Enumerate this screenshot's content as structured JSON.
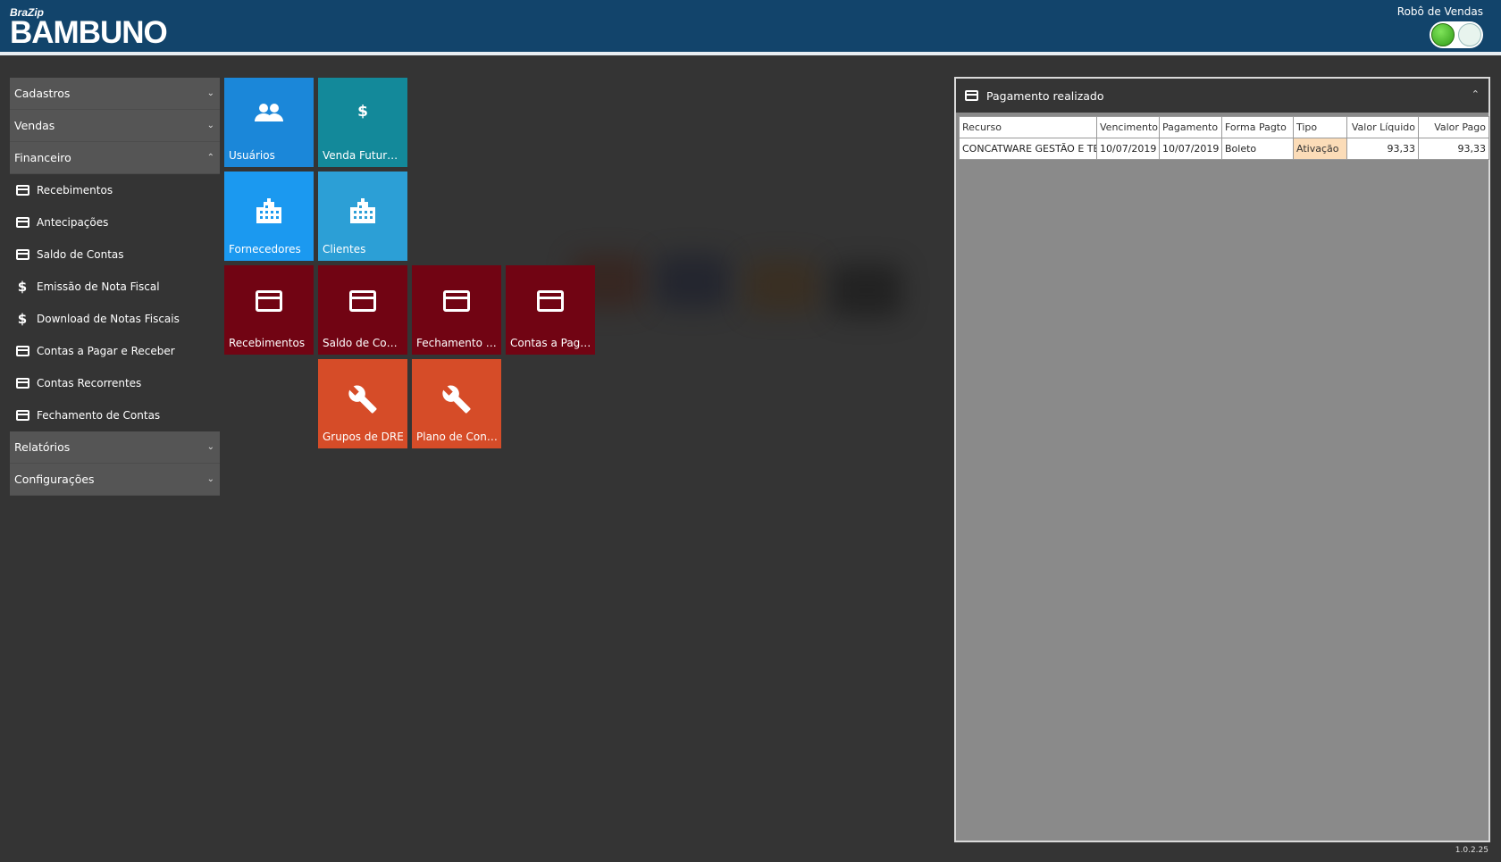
{
  "header": {
    "brand_small": "BraZip",
    "brand_big": "BAMBUNO",
    "robo_label": "Robô de Vendas"
  },
  "sidebar": {
    "groups_top": [
      {
        "label": "Cadastros",
        "chevron": "chevron-down-icon"
      },
      {
        "label": "Vendas",
        "chevron": "chevron-down-icon"
      },
      {
        "label": "Financeiro",
        "chevron": "chevron-up-icon"
      }
    ],
    "items": [
      {
        "label": "Recebimentos",
        "icon": "card-icon"
      },
      {
        "label": "Antecipações",
        "icon": "card-icon"
      },
      {
        "label": "Saldo de Contas",
        "icon": "card-icon"
      },
      {
        "label": "Emissão de Nota Fiscal",
        "icon": "dollar-icon"
      },
      {
        "label": "Download de Notas Fiscais",
        "icon": "dollar-icon"
      },
      {
        "label": "Contas a Pagar e Receber",
        "icon": "card-icon"
      },
      {
        "label": "Contas Recorrentes",
        "icon": "card-icon"
      },
      {
        "label": "Fechamento de Contas",
        "icon": "card-icon"
      }
    ],
    "groups_bottom": [
      {
        "label": "Relatórios",
        "chevron": "chevron-down-icon"
      },
      {
        "label": "Configurações",
        "chevron": "chevron-down-icon"
      }
    ]
  },
  "tiles": {
    "usuarios": "Usuários",
    "venda_futura": "Venda Futura C...",
    "fornecedores": "Fornecedores",
    "clientes": "Clientes",
    "recebimentos": "Recebimentos",
    "saldo_contas": "Saldo de Contas",
    "fechamento": "Fechamento d...",
    "contas_pagar": "Contas a Pagar...",
    "grupos_dre": "Grupos de DRE",
    "plano_contas": "Plano de Contas"
  },
  "panel": {
    "title": "Pagamento realizado",
    "columns": [
      "Recurso",
      "Vencimento",
      "Pagamento",
      "Forma Pagto",
      "Tipo",
      "Valor Líquido",
      "Valor Pago"
    ],
    "rows": [
      [
        "CONCATWARE GESTÃO E TEC",
        "10/07/2019",
        "10/07/2019",
        "Boleto",
        "Ativação",
        "93,33",
        "93,33"
      ]
    ]
  },
  "footer": {
    "version": "1.0.2.25"
  },
  "colors": {
    "header_bg": "#12446b",
    "tile_red": "#710413",
    "tile_orange": "#d64c28",
    "tile_blue": "#1b87d9",
    "highlight": "#fbdcb8"
  }
}
